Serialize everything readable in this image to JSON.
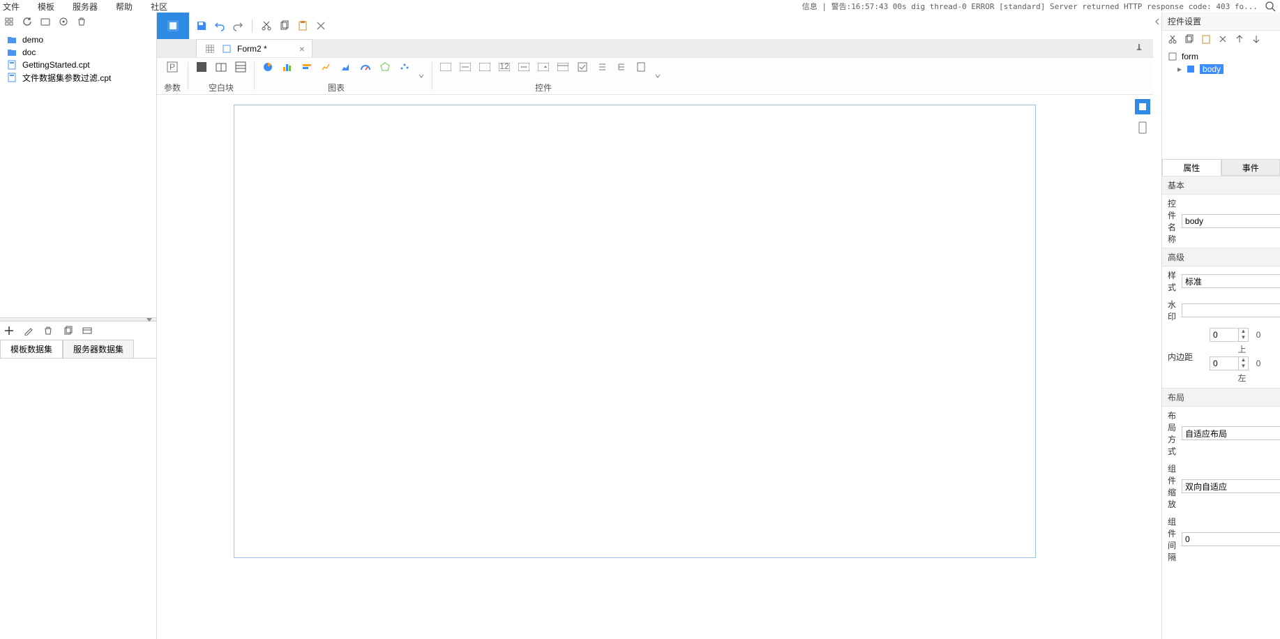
{
  "menu": {
    "file": "文件",
    "template": "模板",
    "server": "服务器",
    "help": "帮助",
    "community": "社区"
  },
  "log_line": "信息 | 警告:16:57:43 00s dig thread-0 ERROR [standard] Server returned HTTP response code: 403 fo...",
  "tree": [
    {
      "type": "folder",
      "name": "demo"
    },
    {
      "type": "folder",
      "name": "doc"
    },
    {
      "type": "file",
      "name": "GettingStarted.cpt"
    },
    {
      "type": "file",
      "name": "文件数据集参数过滤.cpt"
    }
  ],
  "dataset_tabs": {
    "template": "模板数据集",
    "server": "服务器数据集"
  },
  "doc_tab": {
    "label": "Form2 *"
  },
  "ribbon": {
    "param": "参数",
    "blank": "空白块",
    "chart": "图表",
    "widget": "控件"
  },
  "right_panel": {
    "title": "控件设置",
    "outline": {
      "root": "form",
      "child": "body"
    },
    "tabs": {
      "attr": "属性",
      "event": "事件"
    },
    "sections": {
      "basic": "基本",
      "advanced": "高级",
      "layout": "布局"
    },
    "labels": {
      "widget_name": "控件名称",
      "style": "样式",
      "watermark": "水印",
      "padding": "内边距",
      "top": "上",
      "left": "左",
      "layout_mode": "布局方式",
      "scale": "组件缩放",
      "gap": "组件间隔"
    },
    "values": {
      "widget_name": "body",
      "style": "标准",
      "watermark": "",
      "padding_top": "0",
      "padding_left": "0",
      "layout_mode": "自适应布局",
      "scale": "双向自适应",
      "gap": "0"
    }
  }
}
